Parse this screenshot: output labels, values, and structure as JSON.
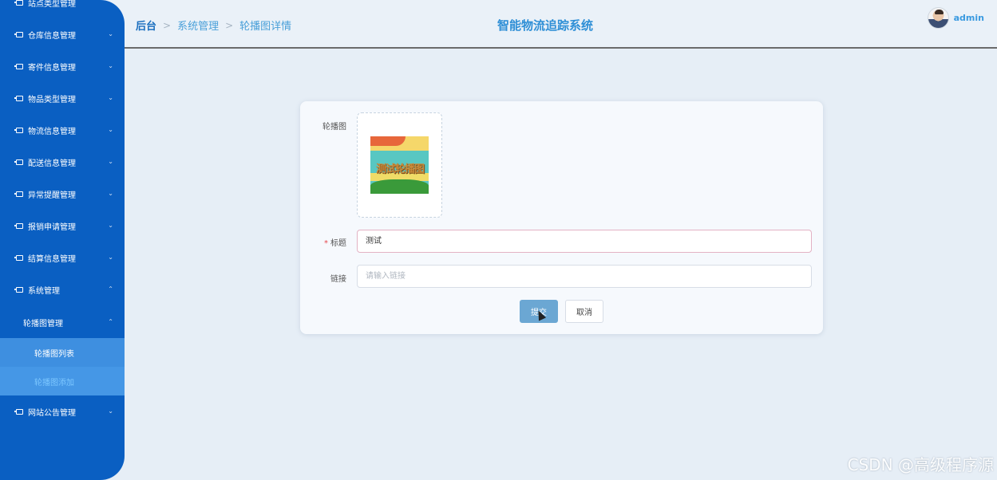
{
  "app": {
    "title": "智能物流追踪系统"
  },
  "breadcrumb": {
    "home": "后台",
    "items": [
      "系统管理",
      "轮播图详情"
    ],
    "separator": ">"
  },
  "user": {
    "name": "admin"
  },
  "sidebar": {
    "items": [
      {
        "label": "站点类型管理"
      },
      {
        "label": "仓库信息管理"
      },
      {
        "label": "寄件信息管理"
      },
      {
        "label": "物品类型管理"
      },
      {
        "label": "物流信息管理"
      },
      {
        "label": "配送信息管理"
      },
      {
        "label": "异常提醒管理"
      },
      {
        "label": "报销申请管理"
      },
      {
        "label": "结算信息管理"
      },
      {
        "label": "系统管理"
      }
    ],
    "submenu": {
      "label": "轮播图管理",
      "items": [
        "轮播图列表",
        "轮播图添加"
      ]
    },
    "last_item": {
      "label": "网站公告管理"
    },
    "chevron_down": "⌄",
    "chevron_up": "⌃",
    "colors": {
      "background": "#0a5fc2",
      "active_text": "#7cc7ff"
    }
  },
  "form": {
    "image_label": "轮播图",
    "thumbnail_text": "测试轮播图",
    "title_label": "标题",
    "required_mark": "*",
    "title_value": "测试",
    "link_label": "链接",
    "link_placeholder": "请输入链接",
    "submit_label": "提交",
    "cancel_label": "取消"
  },
  "watermark": "CSDN @高级程序源"
}
